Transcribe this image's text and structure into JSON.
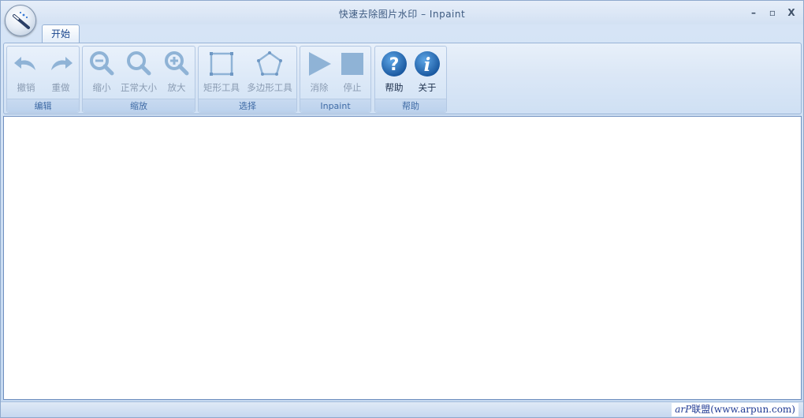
{
  "window": {
    "title": "快速去除图片水印 – Inpaint",
    "controls": {
      "minimize": "–",
      "maximize": "▫",
      "close": "X"
    }
  },
  "tabs": [
    {
      "label": "开始",
      "active": true
    }
  ],
  "ribbon": {
    "groups": [
      {
        "label": "编辑",
        "buttons": [
          {
            "label": "撤销",
            "icon": "undo-icon",
            "enabled": false
          },
          {
            "label": "重做",
            "icon": "redo-icon",
            "enabled": false
          }
        ]
      },
      {
        "label": "缩放",
        "buttons": [
          {
            "label": "缩小",
            "icon": "zoom-out-icon",
            "enabled": false
          },
          {
            "label": "正常大小",
            "icon": "zoom-normal-icon",
            "enabled": false
          },
          {
            "label": "放大",
            "icon": "zoom-in-icon",
            "enabled": false
          }
        ]
      },
      {
        "label": "选择",
        "buttons": [
          {
            "label": "矩形工具",
            "icon": "rectangle-tool-icon",
            "enabled": false
          },
          {
            "label": "多边形工具",
            "icon": "polygon-tool-icon",
            "enabled": false
          }
        ]
      },
      {
        "label": "Inpaint",
        "buttons": [
          {
            "label": "消除",
            "icon": "play-icon",
            "enabled": false
          },
          {
            "label": "停止",
            "icon": "stop-icon",
            "enabled": false
          }
        ]
      },
      {
        "label": "帮助",
        "buttons": [
          {
            "label": "帮助",
            "icon": "help-icon",
            "enabled": true
          },
          {
            "label": "关于",
            "icon": "info-icon",
            "enabled": true
          }
        ]
      }
    ]
  },
  "statusbar": {
    "watermark_prefix": "arP",
    "watermark_rest": "联盟(www.arpun.com)"
  },
  "colors": {
    "accent": "#3e6aa5",
    "icon_disabled": "#8fb3d6",
    "icon_enabled": "#1a66b0",
    "tab_text": "#15428b"
  }
}
